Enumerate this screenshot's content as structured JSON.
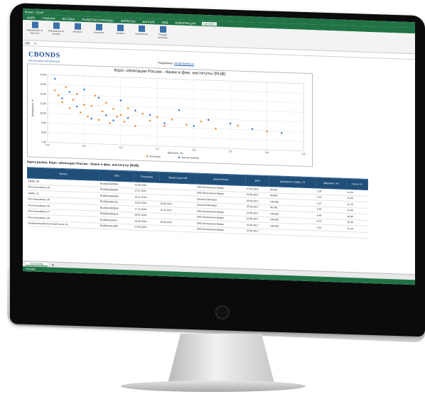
{
  "excel": {
    "title": "Книга1 - Excel",
    "file_tab": "ФАЙЛ",
    "tabs": [
      "ГЛАВНАЯ",
      "ВСТАВКА",
      "РАЗМЕТКА СТРАНИЦЫ",
      "ФОРМУЛЫ",
      "ДАННЫЕ",
      "ВИД",
      "ИНФОРМАЦИЯ",
      "CBONDS"
    ],
    "active_tab": "CBONDS",
    "ribbon_buttons": [
      "Информация по эмитенту",
      "Информация по выпуску",
      "Обновить",
      "Котировки",
      "Графики",
      "Калькулятор",
      "Текущие котировки"
    ],
    "cell_ref": "N56",
    "support_label": "Поддержка:",
    "support_link": "info@cbonds.ru",
    "logo": "CBONDS",
    "logo_sub": "ФИНАНСОВАЯ ИНФОРМАЦИЯ",
    "section_title": "Карта рынка: Корп. облигации России - банки и фин. институты (RUB)",
    "sheet_tab": "CbondsMap",
    "status": "ГОТОВО"
  },
  "chart_data": {
    "type": "scatter",
    "title": "Корп. облигации России - банки и фин. институты (RUB)",
    "xlabel": "Дюрация, лет",
    "ylabel": "Доходность, %",
    "xlim": [
      0.0,
      3.5
    ],
    "ylim": [
      7.0,
      14.0
    ],
    "yticks": [
      "14,00",
      "13,00",
      "12,00",
      "11,00",
      "10,00",
      "9,00",
      "8,00",
      "7,00"
    ],
    "xticks": [
      "0,0",
      "0,5",
      "1,0",
      "1,5",
      "2,0",
      "2,5",
      "3,0",
      "3,5"
    ],
    "legend": [
      "Котировки",
      "Сделки (ask/bid)"
    ],
    "series": [
      {
        "name": "Котировки",
        "color": "#f28a2e",
        "points": [
          [
            0.1,
            12.4
          ],
          [
            0.15,
            11.9
          ],
          [
            0.2,
            11.2
          ],
          [
            0.25,
            12.8
          ],
          [
            0.3,
            10.6
          ],
          [
            0.35,
            11.5
          ],
          [
            0.4,
            12.1
          ],
          [
            0.45,
            10.2
          ],
          [
            0.5,
            11.0
          ],
          [
            0.55,
            9.8
          ],
          [
            0.6,
            10.9
          ],
          [
            0.65,
            12.0
          ],
          [
            0.7,
            9.5
          ],
          [
            0.75,
            10.4
          ],
          [
            0.8,
            11.3
          ],
          [
            0.85,
            9.2
          ],
          [
            0.9,
            10.7
          ],
          [
            0.95,
            9.9
          ],
          [
            1.0,
            10.1
          ],
          [
            1.05,
            9.4
          ],
          [
            1.1,
            10.8
          ],
          [
            1.2,
            9.0
          ],
          [
            1.3,
            10.3
          ],
          [
            1.4,
            9.6
          ],
          [
            1.5,
            10.0
          ],
          [
            1.6,
            9.1
          ],
          [
            1.7,
            9.8
          ],
          [
            1.9,
            9.3
          ],
          [
            2.1,
            9.7
          ],
          [
            2.3,
            9.0
          ],
          [
            2.6,
            9.4
          ],
          [
            3.0,
            8.9
          ]
        ]
      },
      {
        "name": "Сделки (ask/bid)",
        "color": "#4a7bbf",
        "points": [
          [
            0.1,
            13.6
          ],
          [
            0.2,
            11.6
          ],
          [
            0.3,
            12.3
          ],
          [
            0.4,
            10.8
          ],
          [
            0.5,
            12.6
          ],
          [
            0.6,
            9.6
          ],
          [
            0.7,
            11.8
          ],
          [
            0.8,
            10.0
          ],
          [
            0.9,
            9.5
          ],
          [
            1.0,
            11.6
          ],
          [
            1.1,
            9.8
          ],
          [
            1.2,
            10.6
          ],
          [
            1.4,
            10.2
          ],
          [
            1.6,
            9.4
          ],
          [
            1.8,
            10.8
          ],
          [
            2.0,
            9.2
          ],
          [
            2.2,
            9.9
          ],
          [
            2.5,
            9.6
          ],
          [
            2.8,
            9.1
          ],
          [
            3.2,
            8.8
          ]
        ]
      }
    ]
  },
  "table": {
    "headers": [
      "Бумага",
      "ISIN",
      "Погашение",
      "Оферта (put/call)",
      "Эмитент/Банк",
      "Дата",
      "Доходность (эфф.), %",
      "Дюрация, лет",
      "Купон, %"
    ],
    "rows": [
      [
        "АИЖК, 09",
        "RU000A0JRFR4",
        "15.09.2018",
        "",
        "ОАО Московская Биржа",
        "27.05.2015",
        "99,000",
        "1,28",
        "11,00"
      ],
      [
        "Россельхозбанк, 09",
        "RU000A0JRM04",
        "27.07.2017",
        "",
        "ОАО Московская Биржа",
        "22.05.2017",
        "99,500",
        "1,01",
        "11,00"
      ],
      [
        "АИЖК, 11",
        "RU000A0JRGR3",
        "15.11.2019",
        "",
        "Cbonds Estimation",
        "25.05.2017",
        "100,000",
        "2,07",
        "10,75"
      ],
      [
        "Россельхозбанк, 05",
        "RU000A0JRLX0",
        "15.02.2019",
        "15.08.2017",
        "Cbonds Estimation",
        "25.05.2017",
        "99,750",
        "0,25",
        "11,40"
      ],
      [
        "Россельхозбанк, 06",
        "RU000A0JRQU6",
        "17.11.2020",
        "24.11.2017",
        "ОАО Московская Биржа",
        "22.05.2017",
        "100,000",
        "0,48",
        "10,90"
      ],
      [
        "Россельхозбанк, 07",
        "RU000A0JRQV4",
        "09.02.2018",
        "",
        "ОАО Московская Биржа",
        "22.05.2017",
        "100,000",
        "0,70",
        "10,25"
      ],
      [
        "Россельхозбанк, 08",
        "RU000A0JS9T2",
        "26.06.2019",
        "29.06.2017",
        "ОАО Московская Биржа",
        "23.05.2017",
        "100,000",
        "0,10",
        "10,10"
      ],
      [
        "Национальный ипотечный агент, 01",
        "RU000A0JUDZ8",
        "07.08.2019",
        "",
        "ОАО Московская Биржа",
        "22.05.2017",
        "",
        "",
        ""
      ]
    ]
  }
}
